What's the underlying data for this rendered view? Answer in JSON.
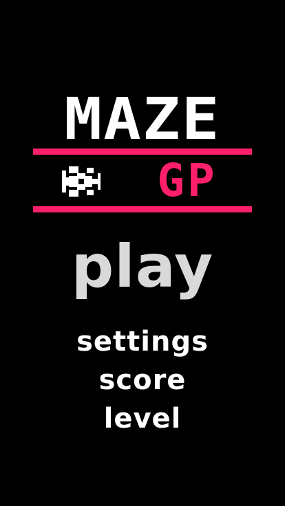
{
  "logo": {
    "title": "MAZE",
    "subtitle": "GP",
    "car_icon": "race-car-icon"
  },
  "menu": {
    "play_label": "play",
    "settings_label": "settings",
    "score_label": "score",
    "level_label": "level"
  },
  "colors": {
    "background": "#000000",
    "accent": "#ff1f6b",
    "title_text": "#ffffff",
    "play_text": "#d9d9d9",
    "menu_text": "#ffffff"
  }
}
